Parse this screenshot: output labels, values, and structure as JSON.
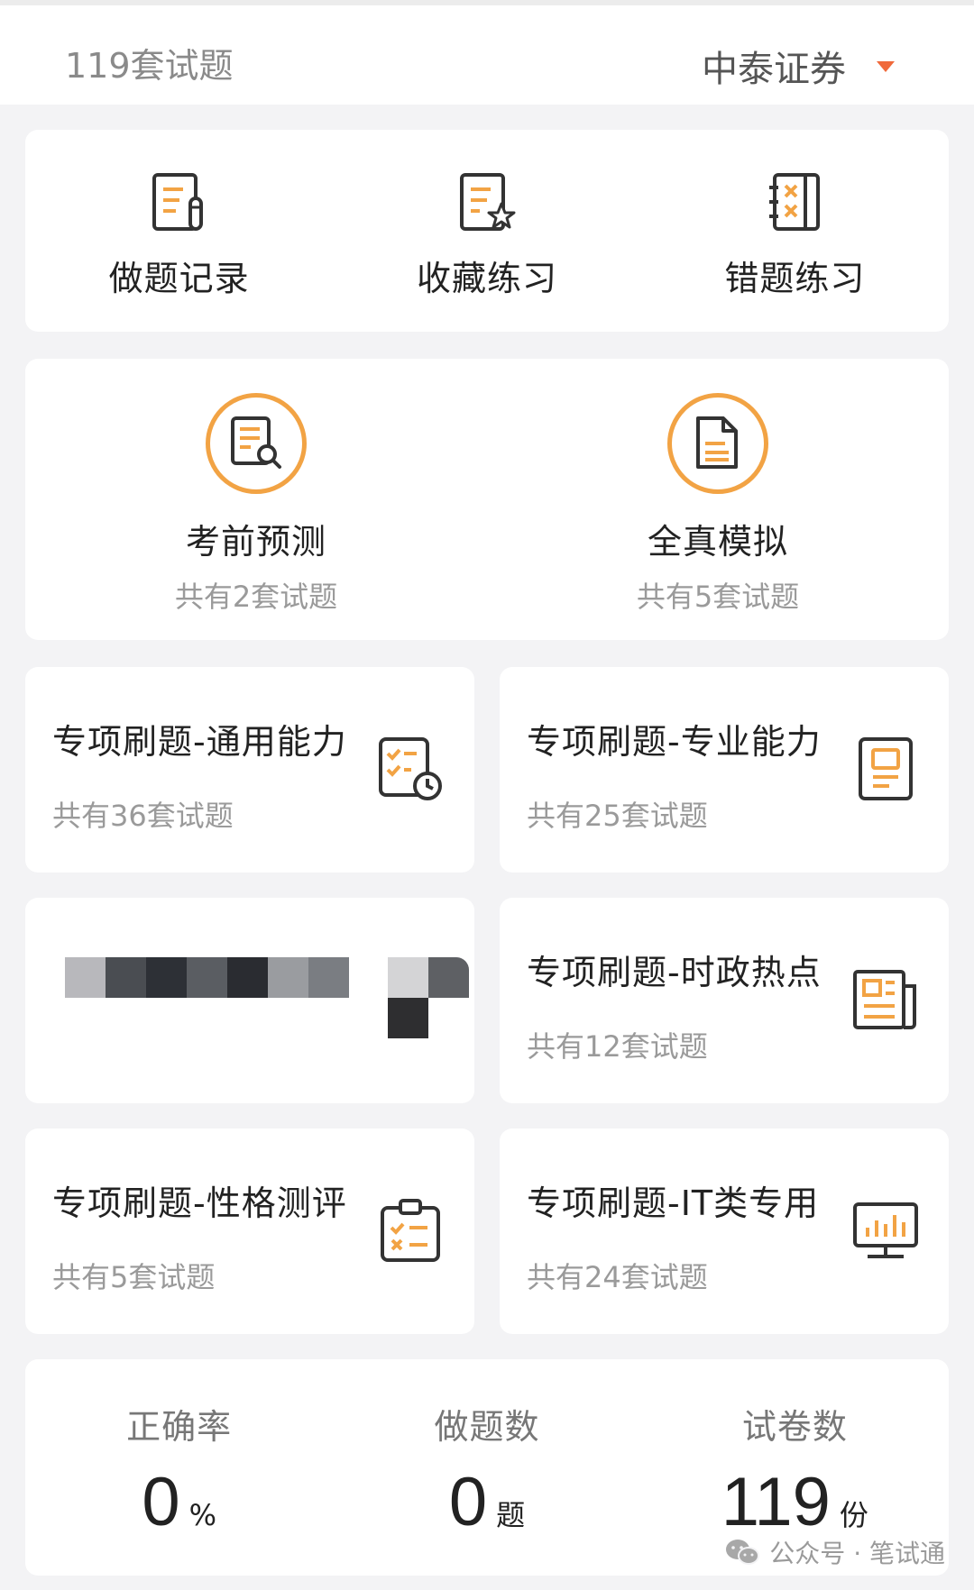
{
  "header": {
    "set_count": "119套试题",
    "company": "中泰证券"
  },
  "functions": [
    {
      "label": "做题记录",
      "icon": "record-icon"
    },
    {
      "label": "收藏练习",
      "icon": "favorite-icon"
    },
    {
      "label": "错题练习",
      "icon": "wrong-notebook-icon"
    }
  ],
  "exams": [
    {
      "title": "考前预测",
      "sub": "共有2套试题",
      "icon": "search-doc-icon"
    },
    {
      "title": "全真模拟",
      "sub": "共有5套试题",
      "icon": "document-icon"
    }
  ],
  "tiles": [
    {
      "title": "专项刷题-通用能力",
      "sub": "共有36套试题",
      "icon": "checklist-clock-icon"
    },
    {
      "title": "专项刷题-专业能力",
      "sub": "共有25套试题",
      "icon": "profile-card-icon"
    },
    {
      "title": "专项刷题-时政热点",
      "sub": "共有12套试题",
      "icon": "newspaper-icon"
    },
    {
      "title": "专项刷题-性格测评",
      "sub": "共有5套试题",
      "icon": "clipboard-icon"
    },
    {
      "title": "专项刷题-IT类专用",
      "sub": "共有24套试题",
      "icon": "monitor-chart-icon"
    }
  ],
  "stats": [
    {
      "label": "正确率",
      "value": "0",
      "unit": "%"
    },
    {
      "label": "做题数",
      "value": "0",
      "unit": "题"
    },
    {
      "label": "试卷数",
      "value": "119",
      "unit": "份"
    }
  ],
  "watermark": "公众号 · 笔试通",
  "colors": {
    "accent": "#f2a344",
    "caret": "#f0693a",
    "icon_stroke": "#333333"
  }
}
